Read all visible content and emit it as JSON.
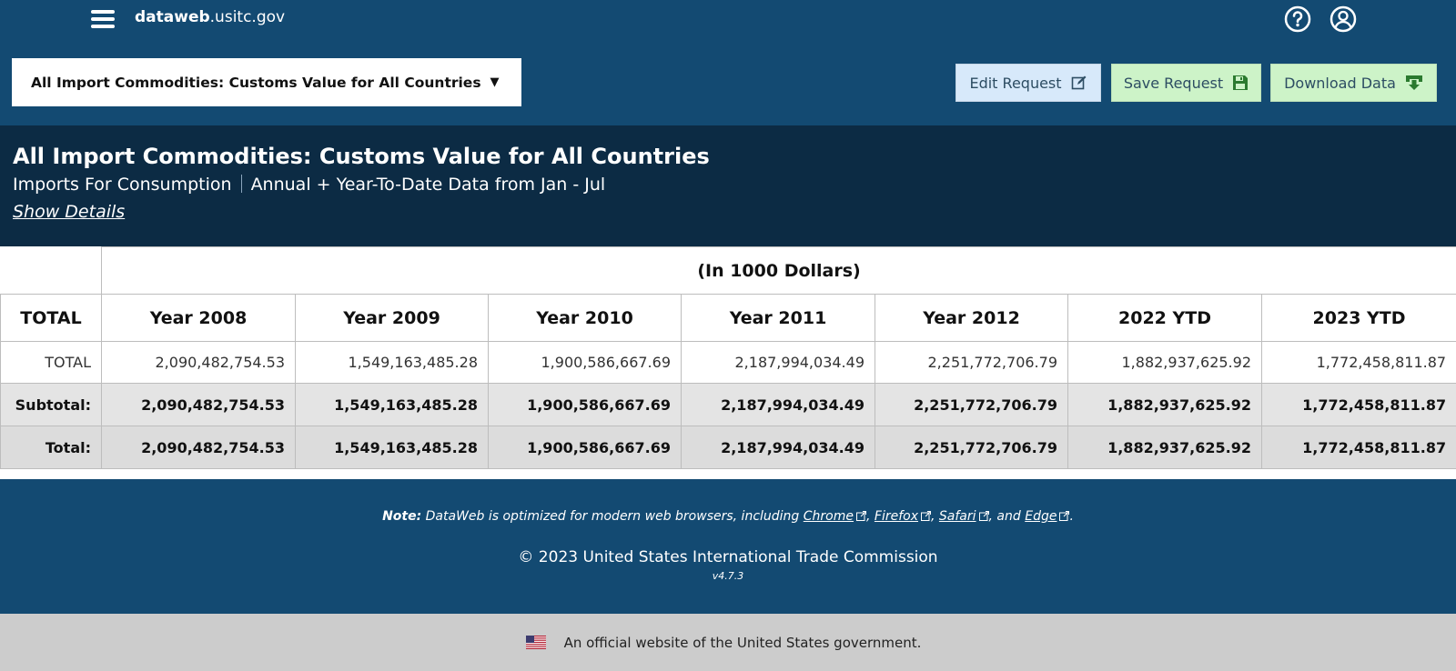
{
  "header": {
    "brand_bold": "dataweb",
    "brand_rest": ".usitc.gov",
    "report_select_label": "All Import Commodities: Customs Value for All Countries",
    "report_select_caret": "▼",
    "edit_label": "Edit Request",
    "save_label": "Save Request",
    "download_label": "Download Data"
  },
  "report": {
    "title": "All Import Commodities: Customs Value for All Countries",
    "subtitle_left": "Imports For Consumption",
    "subtitle_right": "Annual + Year-To-Date Data from Jan - Jul",
    "show_details": "Show Details"
  },
  "table": {
    "units": "(In 1000 Dollars)",
    "row_header": "TOTAL",
    "columns": [
      "Year 2008",
      "Year 2009",
      "Year 2010",
      "Year 2011",
      "Year 2012",
      "2022 YTD",
      "2023 YTD"
    ],
    "rows": [
      {
        "label": "TOTAL",
        "values": [
          "2,090,482,754.53",
          "1,549,163,485.28",
          "1,900,586,667.69",
          "2,187,994,034.49",
          "2,251,772,706.79",
          "1,882,937,625.92",
          "1,772,458,811.87"
        ]
      },
      {
        "label": "Subtotal:",
        "values": [
          "2,090,482,754.53",
          "1,549,163,485.28",
          "1,900,586,667.69",
          "2,187,994,034.49",
          "2,251,772,706.79",
          "1,882,937,625.92",
          "1,772,458,811.87"
        ]
      },
      {
        "label": "Total:",
        "values": [
          "2,090,482,754.53",
          "1,549,163,485.28",
          "1,900,586,667.69",
          "2,187,994,034.49",
          "2,251,772,706.79",
          "1,882,937,625.92",
          "1,772,458,811.87"
        ]
      }
    ]
  },
  "footer": {
    "note_bold": "Note:",
    "note_text": "DataWeb is optimized for modern web browsers, including",
    "browsers": [
      "Chrome",
      "Firefox",
      "Safari",
      "Edge"
    ],
    "sep1": ",",
    "sep2": ",",
    "sep3": ", and",
    "end": ".",
    "copyright": "© 2023 United States International Trade Commission",
    "version": "v4.7.3",
    "gov_banner": "An official website of the United States government."
  },
  "colors": {
    "nav_bg": "#134a72",
    "report_head_bg": "#0c2b44",
    "edit_btn_bg": "#d7e9fa",
    "save_btn_bg": "#cdf3c8",
    "subtotal_bg": "#e4e4e4",
    "gov_banner_bg": "#cccccc"
  },
  "icons": {
    "menu": "hamburger-menu-icon",
    "help": "question-circle-icon",
    "user": "user-account-icon",
    "edit": "edit-pencil-icon",
    "save": "floppy-disk-icon",
    "download": "download-arrow-icon",
    "external": "external-link-icon",
    "flag": "us-flag-icon"
  }
}
